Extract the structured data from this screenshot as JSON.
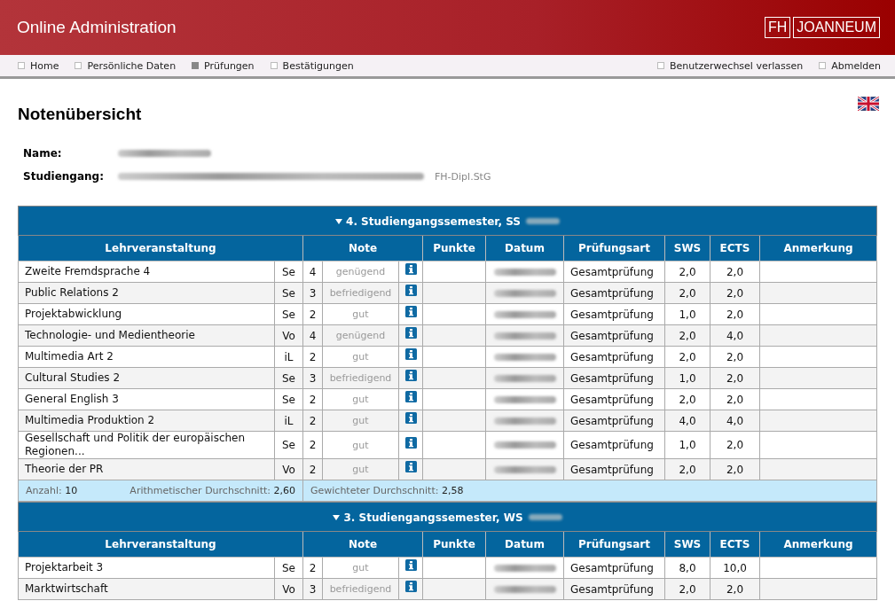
{
  "header": {
    "title": "Online Administration",
    "logo": [
      "FH",
      "JOANNEUM"
    ]
  },
  "nav": {
    "left": [
      {
        "label": "Home",
        "selected": false
      },
      {
        "label": "Persönliche Daten",
        "selected": false
      },
      {
        "label": "Prüfungen",
        "selected": true
      },
      {
        "label": "Bestätigungen",
        "selected": false
      }
    ],
    "right": [
      {
        "label": "Benutzerwechsel verlassen",
        "selected": false
      },
      {
        "label": "Abmelden",
        "selected": false
      }
    ]
  },
  "page_title": "Notenübersicht",
  "info": [
    {
      "label": "Name:"
    },
    {
      "label": "Studiengang:",
      "suffix": "FH-Dipl.StG"
    }
  ],
  "semesters": [
    {
      "title": "4. Studiengangssemester, SS",
      "expanded": true,
      "columns": [
        "Lehrveranstaltung",
        "Note",
        "Punkte",
        "Datum",
        "Prüfungsart",
        "SWS",
        "ECTS",
        "Anmerkung"
      ],
      "rows": [
        {
          "course": "Zweite Fremdsprache 4",
          "type": "Se",
          "grade": "4",
          "grade_text": "genügend",
          "exam": "Gesamtprüfung",
          "sws": "2,0",
          "ects": "2,0"
        },
        {
          "course": "Public Relations 2",
          "type": "Se",
          "grade": "3",
          "grade_text": "befriedigend",
          "exam": "Gesamtprüfung",
          "sws": "2,0",
          "ects": "2,0"
        },
        {
          "course": "Projektabwicklung",
          "type": "Se",
          "grade": "2",
          "grade_text": "gut",
          "exam": "Gesamtprüfung",
          "sws": "1,0",
          "ects": "2,0"
        },
        {
          "course": "Technologie- und Medientheorie",
          "type": "Vo",
          "grade": "4",
          "grade_text": "genügend",
          "exam": "Gesamtprüfung",
          "sws": "2,0",
          "ects": "4,0"
        },
        {
          "course": "Multimedia Art 2",
          "type": "iL",
          "grade": "2",
          "grade_text": "gut",
          "exam": "Gesamtprüfung",
          "sws": "2,0",
          "ects": "2,0"
        },
        {
          "course": "Cultural Studies 2",
          "type": "Se",
          "grade": "3",
          "grade_text": "befriedigend",
          "exam": "Gesamtprüfung",
          "sws": "1,0",
          "ects": "2,0"
        },
        {
          "course": "General English 3",
          "type": "Se",
          "grade": "2",
          "grade_text": "gut",
          "exam": "Gesamtprüfung",
          "sws": "2,0",
          "ects": "2,0"
        },
        {
          "course": "Multimedia Produktion 2",
          "type": "iL",
          "grade": "2",
          "grade_text": "gut",
          "exam": "Gesamtprüfung",
          "sws": "4,0",
          "ects": "4,0"
        },
        {
          "course": "Gesellschaft und Politik der europäischen Regionen...",
          "type": "Se",
          "grade": "2",
          "grade_text": "gut",
          "exam": "Gesamtprüfung",
          "sws": "1,0",
          "ects": "2,0"
        },
        {
          "course": "Theorie der PR",
          "type": "Vo",
          "grade": "2",
          "grade_text": "gut",
          "exam": "Gesamtprüfung",
          "sws": "2,0",
          "ects": "2,0"
        }
      ],
      "summary": {
        "count_label": "Anzahl:",
        "count": "10",
        "mean_label": "Arithmetischer Durchschnitt:",
        "mean": "2,60",
        "weighted_label": "Gewichteter Durchschnitt:",
        "weighted": "2,58"
      }
    },
    {
      "title": "3. Studiengangssemester, WS",
      "expanded": true,
      "columns": [
        "Lehrveranstaltung",
        "Note",
        "Punkte",
        "Datum",
        "Prüfungsart",
        "SWS",
        "ECTS",
        "Anmerkung"
      ],
      "rows": [
        {
          "course": "Projektarbeit 3",
          "type": "Se",
          "grade": "2",
          "grade_text": "gut",
          "exam": "Gesamtprüfung",
          "sws": "8,0",
          "ects": "10,0"
        },
        {
          "course": "Marktwirtschaft",
          "type": "Vo",
          "grade": "3",
          "grade_text": "befriedigend",
          "exam": "Gesamtprüfung",
          "sws": "2,0",
          "ects": "2,0"
        }
      ]
    }
  ]
}
